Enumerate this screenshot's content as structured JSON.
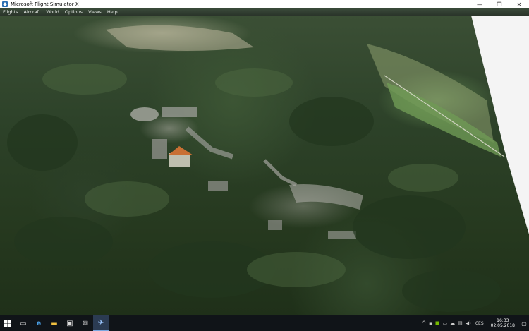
{
  "window": {
    "title": "Microsoft Flight Simulator X",
    "controls": {
      "minimize": "—",
      "maximize": "❐",
      "close": "✕"
    }
  },
  "menu": {
    "items": [
      "Flights",
      "Aircraft",
      "World",
      "Options",
      "Views",
      "Help"
    ]
  },
  "taskbar": {
    "start_icon": "windows-logo-icon",
    "apps": [
      {
        "name": "task-view-icon",
        "glyph": "▭"
      },
      {
        "name": "edge-browser-icon",
        "glyph": "e"
      },
      {
        "name": "file-explorer-icon",
        "glyph": "▬"
      },
      {
        "name": "store-icon",
        "glyph": "▣"
      },
      {
        "name": "mail-icon",
        "glyph": "✉"
      },
      {
        "name": "flight-simulator-icon",
        "glyph": "✈"
      }
    ],
    "tray": {
      "icons": [
        "chevron-up-icon",
        "app-tray-icon",
        "nvidia-icon",
        "battery-icon",
        "cloud-icon",
        "network-icon",
        "volume-icon"
      ],
      "language": "CES",
      "time": "16:33",
      "date": "02.05.2018"
    }
  }
}
